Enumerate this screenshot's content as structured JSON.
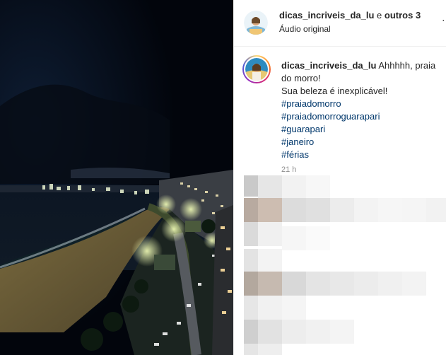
{
  "header": {
    "username": "dicas_incriveis_da_lu",
    "conjunction": " e ",
    "others": "outros 3",
    "audio": "Áudio original",
    "icons": [
      "avatar",
      "more-icon"
    ]
  },
  "caption": {
    "username": "dicas_incriveis_da_lu",
    "text_line1": " Ahhhhh, praia do morro!",
    "text_line2": "Sua beleza é inexplicável!",
    "hashtags": [
      "#praiadomorro",
      "#praiadomorroguarapari",
      "#guarapari",
      "#janeiro",
      "#férias"
    ],
    "time": "21 h"
  },
  "colors": {
    "text": "#262626",
    "hashtag": "#00376b",
    "muted": "#8e8e8e",
    "divider": "#efefef"
  }
}
